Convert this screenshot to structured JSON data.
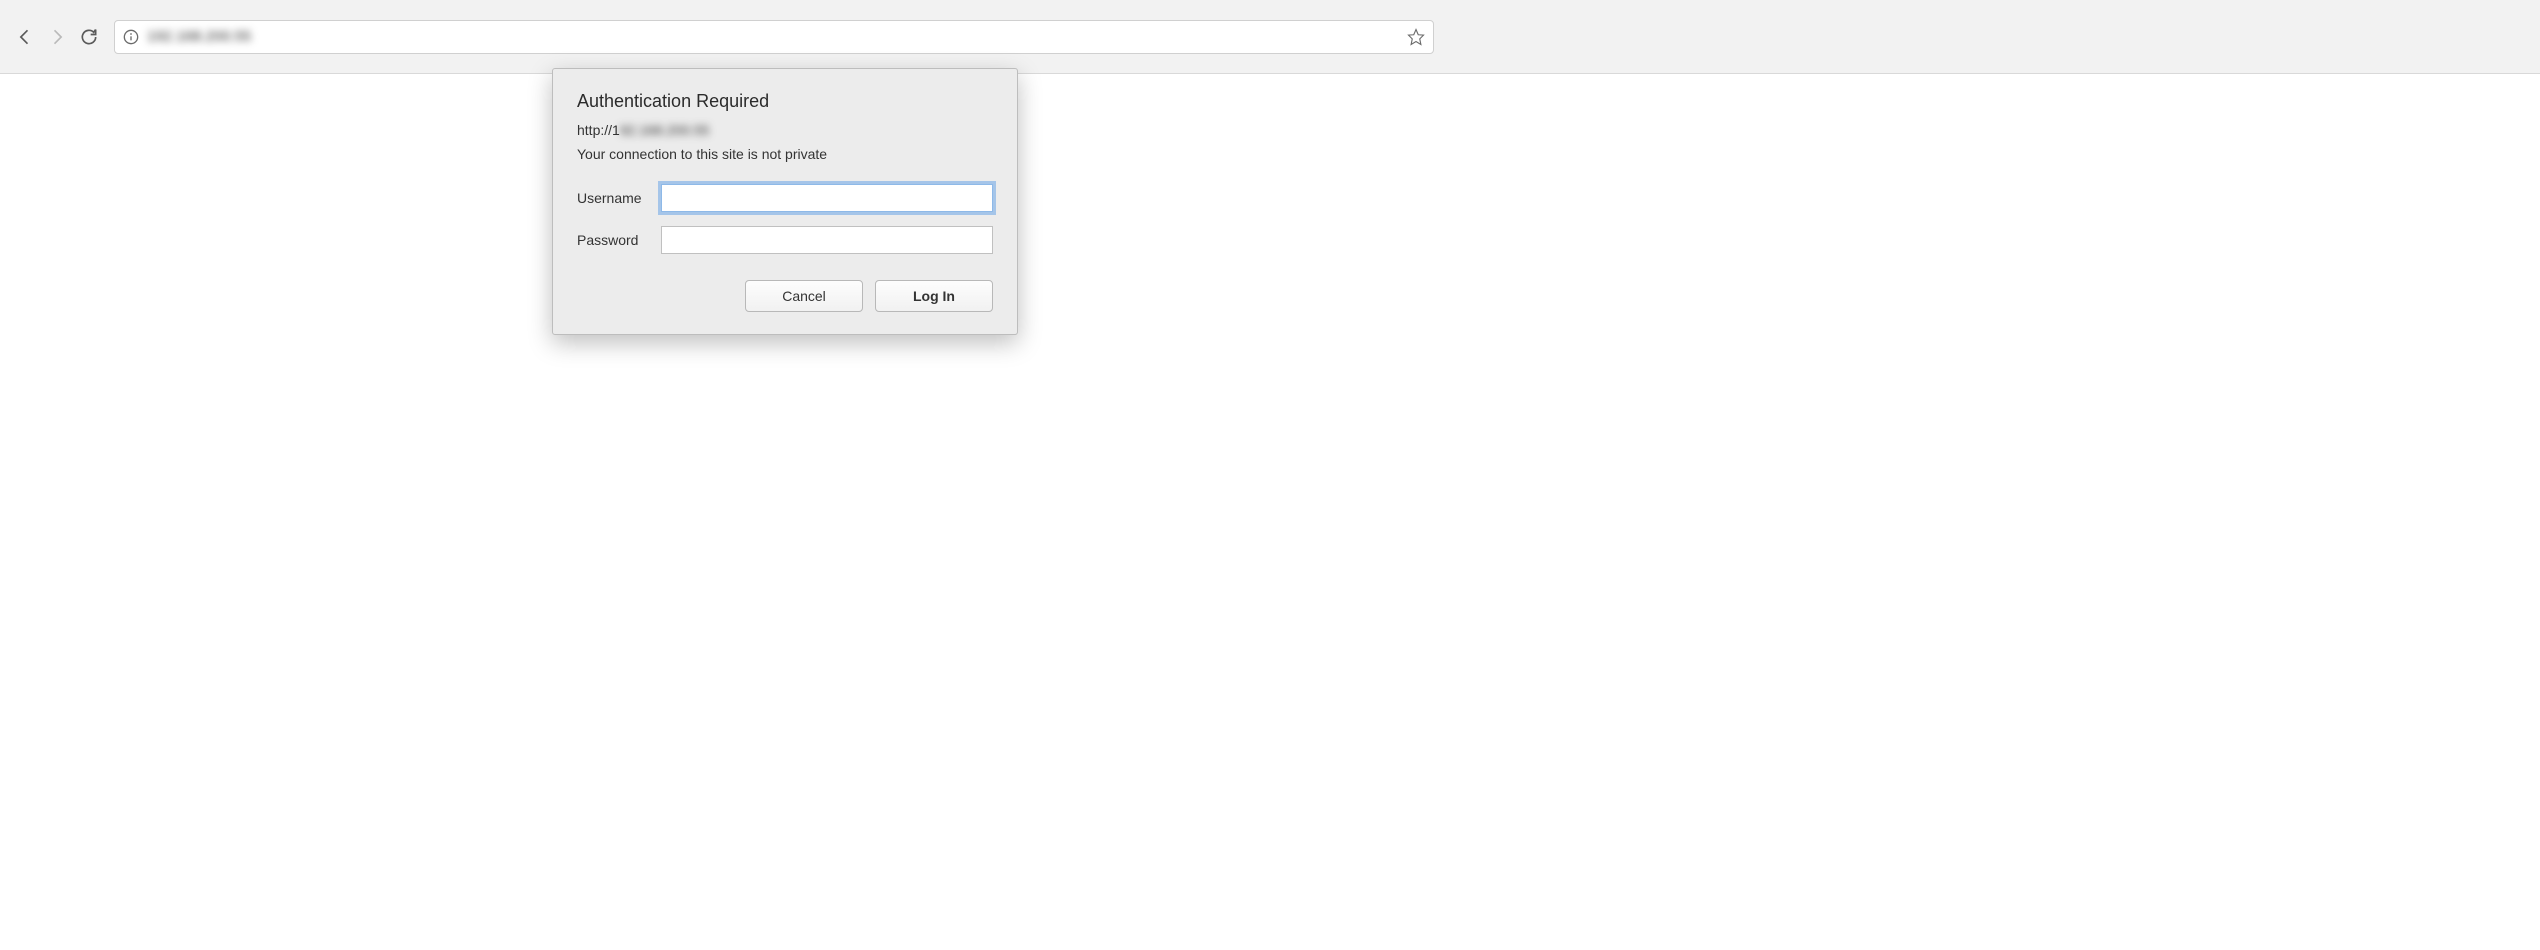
{
  "browser": {
    "url_display": "192.168.200.55",
    "nav": {
      "back_enabled": true,
      "forward_enabled": false
    }
  },
  "dialog": {
    "title": "Authentication Required",
    "url_prefix": "http://1",
    "url_blurred": "92.168.200.55",
    "warning": "Your connection to this site is not private",
    "username_label": "Username",
    "password_label": "Password",
    "username_value": "",
    "password_value": "",
    "cancel_label": "Cancel",
    "login_label": "Log In"
  }
}
